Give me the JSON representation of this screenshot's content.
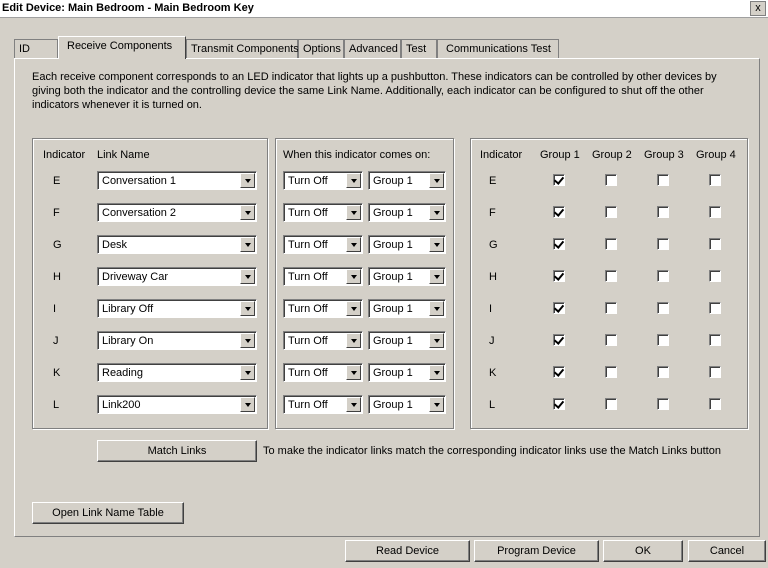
{
  "window": {
    "title": "Edit Device: Main Bedroom - Main Bedroom Key",
    "close": "x"
  },
  "tabs": [
    "ID",
    "Receive Components",
    "Transmit Components",
    "Options",
    "Advanced",
    "Test",
    "Communications Test"
  ],
  "active_tab": "Receive Components",
  "description": "Each receive component corresponds to an LED indicator that lights up a pushbutton.  These indicators can be controlled by other devices by giving both the indicator and the controlling device the same Link Name.  Additionally, each indicator can be configured to shut off the other indicators whenever it is turned on.",
  "headers": {
    "indicator": "Indicator",
    "link_name": "Link Name",
    "when_on": "When this indicator comes on:",
    "indicator2": "Indicator",
    "group1": "Group 1",
    "group2": "Group 2",
    "group3": "Group 3",
    "group4": "Group 4"
  },
  "rows": [
    {
      "indicator": "E",
      "link_name": "Conversation 1",
      "action": "Turn Off",
      "group": "Group 1",
      "groups": [
        true,
        false,
        false,
        false
      ]
    },
    {
      "indicator": "F",
      "link_name": "Conversation 2",
      "action": "Turn Off",
      "group": "Group 1",
      "groups": [
        true,
        false,
        false,
        false
      ]
    },
    {
      "indicator": "G",
      "link_name": "Desk",
      "action": "Turn Off",
      "group": "Group 1",
      "groups": [
        true,
        false,
        false,
        false
      ]
    },
    {
      "indicator": "H",
      "link_name": "Driveway Car",
      "action": "Turn Off",
      "group": "Group 1",
      "groups": [
        true,
        false,
        false,
        false
      ]
    },
    {
      "indicator": "I",
      "link_name": "Library Off",
      "action": "Turn Off",
      "group": "Group 1",
      "groups": [
        true,
        false,
        false,
        false
      ]
    },
    {
      "indicator": "J",
      "link_name": "Library On",
      "action": "Turn Off",
      "group": "Group 1",
      "groups": [
        true,
        false,
        false,
        false
      ]
    },
    {
      "indicator": "K",
      "link_name": "Reading",
      "action": "Turn Off",
      "group": "Group 1",
      "groups": [
        true,
        false,
        false,
        false
      ]
    },
    {
      "indicator": "L",
      "link_name": "Link200",
      "action": "Turn Off",
      "group": "Group 1",
      "groups": [
        true,
        false,
        false,
        false
      ]
    }
  ],
  "match_links": {
    "button": "Match Links",
    "help": "To make the indicator links match the corresponding indicator links use the Match Links button"
  },
  "open_table_button": "Open Link Name Table",
  "footer": {
    "read": "Read Device",
    "program": "Program Device",
    "ok": "OK",
    "cancel": "Cancel"
  }
}
